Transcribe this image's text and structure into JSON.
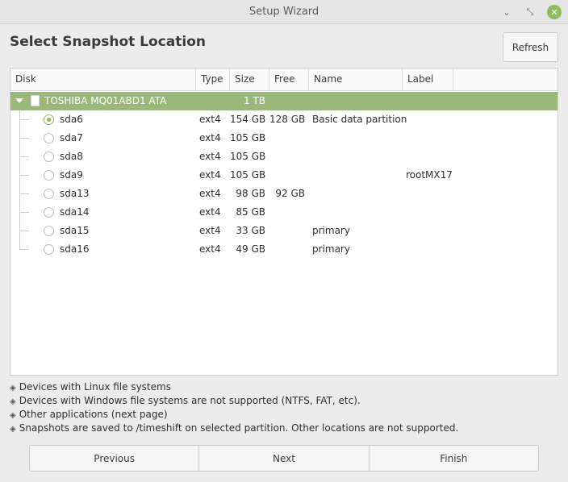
{
  "window": {
    "title": "Setup Wizard"
  },
  "header": {
    "title": "Select Snapshot Location",
    "refresh_label": "Refresh"
  },
  "table": {
    "columns": [
      "Disk",
      "Type",
      "Size",
      "Free",
      "Name",
      "Label"
    ],
    "disk": {
      "name": "TOSHIBA MQ01ABD1 ATA",
      "size": "1 TB"
    },
    "partitions": [
      {
        "device": "sda6",
        "type": "ext4",
        "size": "154 GB",
        "free": "128 GB",
        "name": "Basic data partition",
        "label": "",
        "selected": true
      },
      {
        "device": "sda7",
        "type": "ext4",
        "size": "105 GB",
        "free": "",
        "name": "",
        "label": "",
        "selected": false
      },
      {
        "device": "sda8",
        "type": "ext4",
        "size": "105 GB",
        "free": "",
        "name": "",
        "label": "",
        "selected": false
      },
      {
        "device": "sda9",
        "type": "ext4",
        "size": "105 GB",
        "free": "",
        "name": "",
        "label": "rootMX17",
        "selected": false
      },
      {
        "device": "sda13",
        "type": "ext4",
        "size": "98 GB",
        "free": "92 GB",
        "name": "",
        "label": "",
        "selected": false
      },
      {
        "device": "sda14",
        "type": "ext4",
        "size": "85 GB",
        "free": "",
        "name": "",
        "label": "",
        "selected": false
      },
      {
        "device": "sda15",
        "type": "ext4",
        "size": "33 GB",
        "free": "",
        "name": "primary",
        "label": "",
        "selected": false
      },
      {
        "device": "sda16",
        "type": "ext4",
        "size": "49 GB",
        "free": "",
        "name": "primary",
        "label": "",
        "selected": false
      }
    ]
  },
  "notes": [
    "Devices with Linux file systems",
    "Devices with Windows file systems are not supported (NTFS, FAT, etc).",
    "Other applications (next page)",
    "Snapshots are saved to /timeshift on selected partition. Other locations are not supported."
  ],
  "nav": {
    "previous_label": "Previous",
    "next_label": "Next",
    "finish_label": "Finish"
  },
  "colors": {
    "accent": "#8fbc5e",
    "selected_row": "#9ab87a"
  }
}
